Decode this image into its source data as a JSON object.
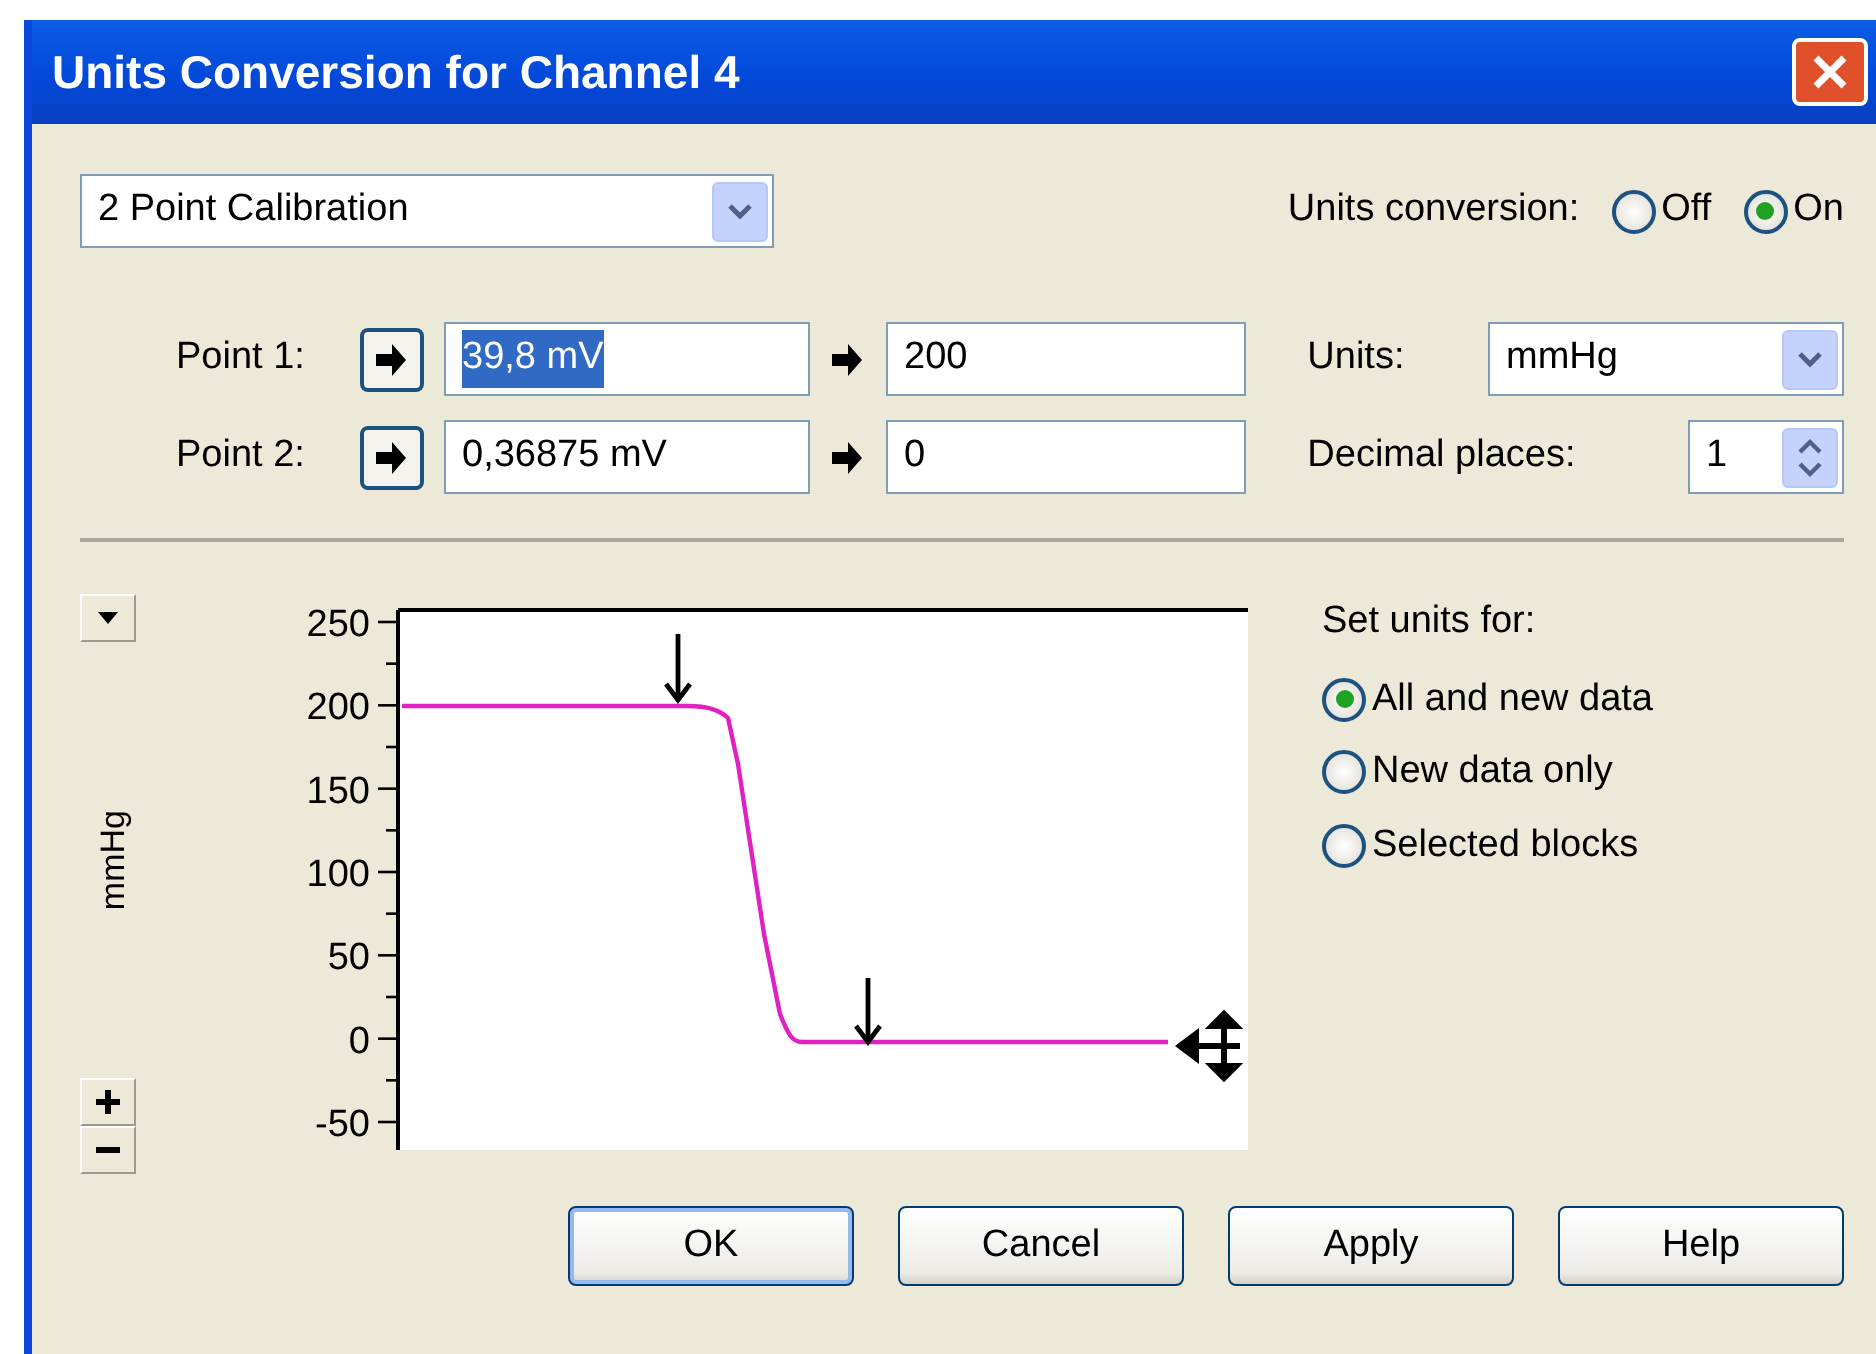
{
  "window": {
    "title": "Units Conversion for Channel 4"
  },
  "mode_select": {
    "value": "2 Point Calibration"
  },
  "units_conversion": {
    "label": "Units conversion:",
    "options": [
      {
        "label": "Off",
        "selected": false
      },
      {
        "label": "On",
        "selected": true
      }
    ]
  },
  "points": [
    {
      "label": "Point 1:",
      "input": "39,8 mV",
      "input_selected": true,
      "output": "200"
    },
    {
      "label": "Point 2:",
      "input": "0,36875 mV",
      "input_selected": false,
      "output": "0"
    }
  ],
  "units": {
    "label": "Units:",
    "value": "mmHg"
  },
  "decimal_places": {
    "label": "Decimal places:",
    "value": "1"
  },
  "chart": {
    "ylabel": "mmHg",
    "tick_labels": [
      "250",
      "200",
      "150",
      "100",
      "50",
      "0",
      "-50"
    ]
  },
  "set_units_for": {
    "label": "Set units for:",
    "options": [
      {
        "label": "All and new data",
        "selected": true
      },
      {
        "label": "New data only",
        "selected": false
      },
      {
        "label": "Selected blocks",
        "selected": false
      }
    ]
  },
  "buttons": [
    {
      "label": "OK",
      "default": true
    },
    {
      "label": "Cancel",
      "default": false
    },
    {
      "label": "Apply",
      "default": false
    },
    {
      "label": "Help",
      "default": false
    }
  ]
}
